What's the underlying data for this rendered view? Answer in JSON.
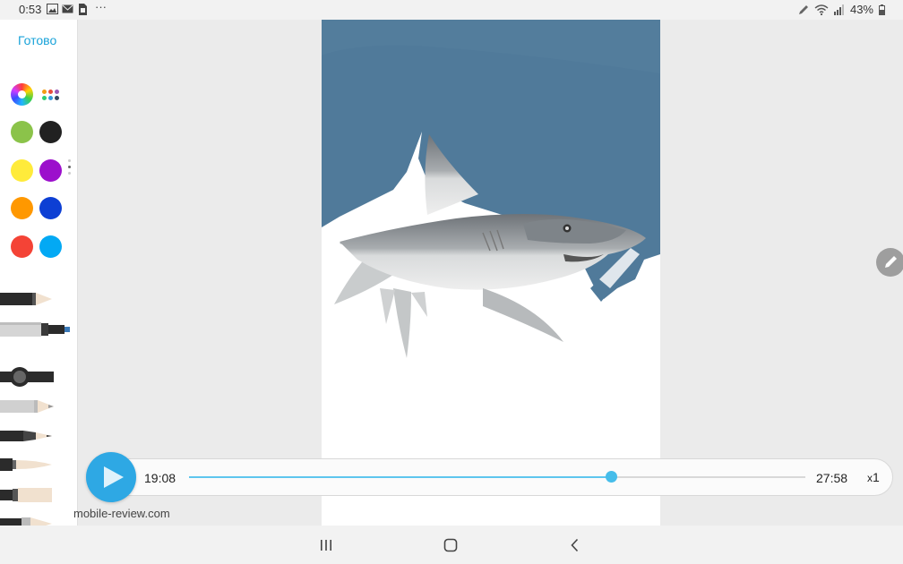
{
  "status_bar": {
    "time": "0:53",
    "left_icons": [
      "image-icon",
      "mail-icon",
      "sim-card-icon",
      "more-dots-icon"
    ],
    "more": "···",
    "right_icons": [
      "pen-icon",
      "wifi-icon",
      "signal-icon",
      "battery-icon"
    ],
    "battery": "43%"
  },
  "tool_panel": {
    "done_label": "Готово",
    "colors": [
      "#8bc34a",
      "#212121",
      "#ffeb3b",
      "#9c0fcc",
      "#ff9800",
      "#0d3fd4",
      "#f44336",
      "#03a9f4"
    ],
    "brushes": [
      "pen",
      "marker",
      "calligraphy-brush",
      "pencil",
      "fountain-pen",
      "ink-brush",
      "flat-brush",
      "eraser-brush"
    ]
  },
  "playback": {
    "current_time": "19:08",
    "total_time": "27:58",
    "speed_prefix": "x",
    "speed_value": "1",
    "progress": 0.684
  },
  "watermark": "mobile-review.com",
  "accent_color": "#2ea8e4"
}
